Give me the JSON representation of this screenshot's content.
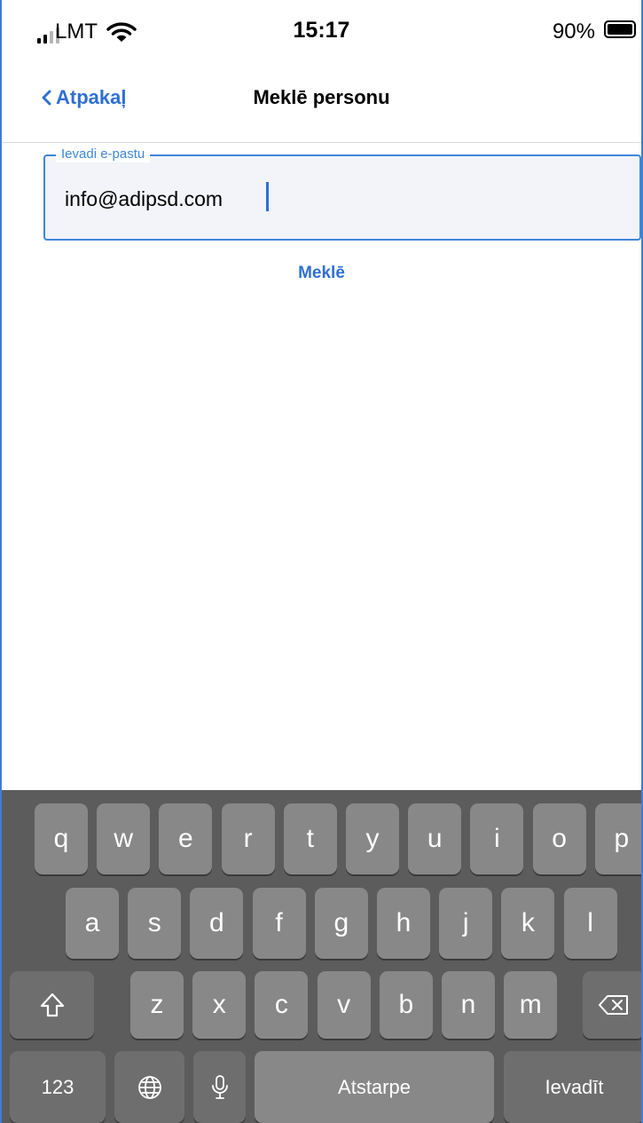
{
  "status_bar": {
    "carrier": "LMT",
    "time": "15:17",
    "battery": "90%"
  },
  "nav": {
    "back_label": "Atpakaļ",
    "title": "Meklē personu"
  },
  "form": {
    "email_label": "Ievadi e-pastu",
    "email_value": "info@adipsd.com",
    "search_label": "Meklē"
  },
  "keyboard": {
    "row1": [
      "q",
      "w",
      "e",
      "r",
      "t",
      "y",
      "u",
      "i",
      "o",
      "p"
    ],
    "row2": [
      "a",
      "s",
      "d",
      "f",
      "g",
      "h",
      "j",
      "k",
      "l"
    ],
    "row3": [
      "z",
      "x",
      "c",
      "v",
      "b",
      "n",
      "m"
    ],
    "numbers_label": "123",
    "space_label": "Atstarpe",
    "return_label": "Ievadīt"
  },
  "colors": {
    "accent": "#2f6fd3",
    "field_border": "#3f86d8",
    "keyboard_bg": "#5c5c5c",
    "key_bg": "#888888"
  }
}
